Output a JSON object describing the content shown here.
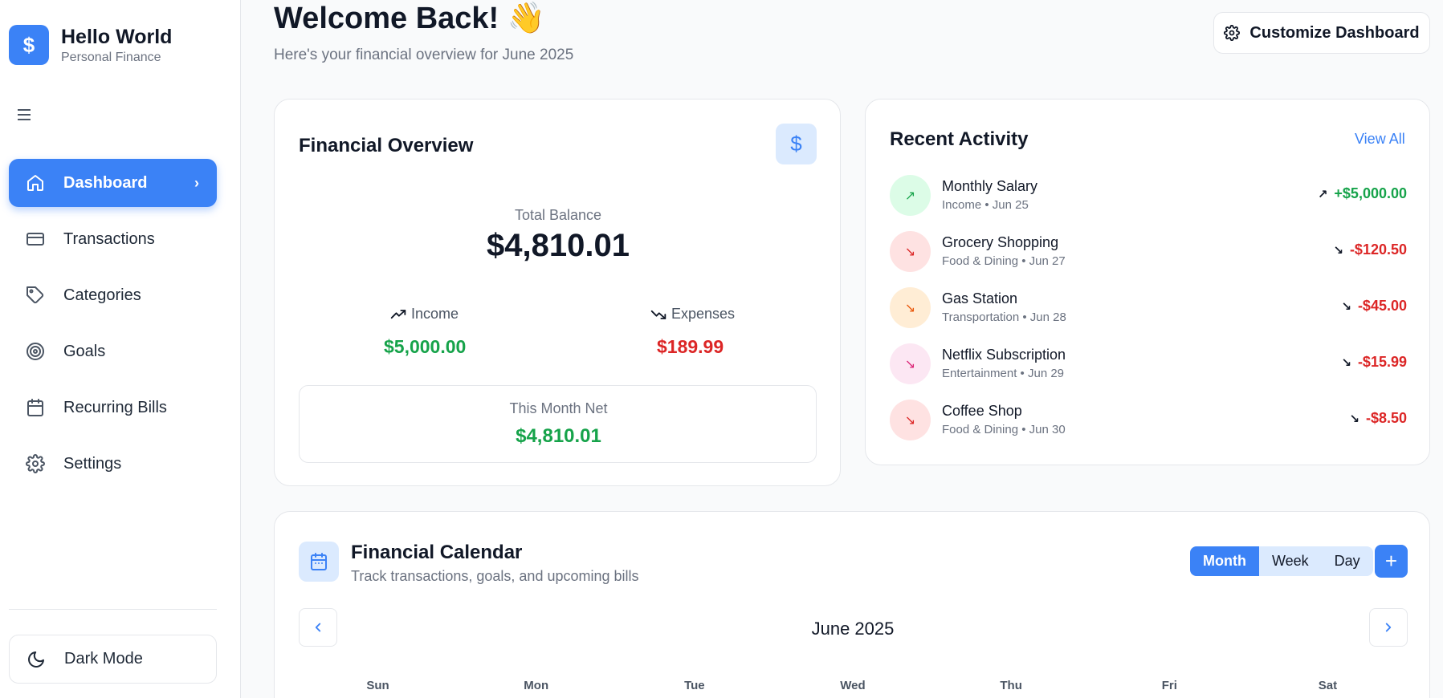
{
  "brand": {
    "name": "Hello World",
    "subtitle": "Personal Finance",
    "logo_symbol": "$"
  },
  "sidebar": {
    "items": [
      {
        "label": "Dashboard",
        "icon": "home-icon",
        "active": true
      },
      {
        "label": "Transactions",
        "icon": "credit-card-icon"
      },
      {
        "label": "Categories",
        "icon": "tag-icon"
      },
      {
        "label": "Goals",
        "icon": "target-icon"
      },
      {
        "label": "Recurring Bills",
        "icon": "calendar-icon"
      },
      {
        "label": "Settings",
        "icon": "gear-icon"
      }
    ],
    "dark_mode_label": "Dark Mode"
  },
  "header": {
    "title": "Welcome Back! 👋",
    "subtitle": "Here's your financial overview for June 2025",
    "customize_label": "Customize Dashboard"
  },
  "overview": {
    "title": "Financial Overview",
    "balance_label": "Total Balance",
    "balance_value": "$4,810.01",
    "income_label": "Income",
    "income_value": "$5,000.00",
    "expenses_label": "Expenses",
    "expenses_value": "$189.99",
    "net_label": "This Month Net",
    "net_value": "$4,810.01"
  },
  "activity": {
    "title": "Recent Activity",
    "view_all": "View All",
    "items": [
      {
        "name": "Monthly Salary",
        "meta": "Income • Jun 25",
        "amount": "+$5,000.00",
        "type": "income",
        "bg": "#dcfce7",
        "color": "#16a34a"
      },
      {
        "name": "Grocery Shopping",
        "meta": "Food & Dining • Jun 27",
        "amount": "-$120.50",
        "type": "expense",
        "bg": "#fee2e2",
        "color": "#dc2626"
      },
      {
        "name": "Gas Station",
        "meta": "Transportation • Jun 28",
        "amount": "-$45.00",
        "type": "expense",
        "bg": "#ffedd5",
        "color": "#ea580c"
      },
      {
        "name": "Netflix Subscription",
        "meta": "Entertainment • Jun 29",
        "amount": "-$15.99",
        "type": "expense",
        "bg": "#fce7f3",
        "color": "#db2777"
      },
      {
        "name": "Coffee Shop",
        "meta": "Food & Dining • Jun 30",
        "amount": "-$8.50",
        "type": "expense",
        "bg": "#fee2e2",
        "color": "#dc2626"
      }
    ]
  },
  "calendar": {
    "title": "Financial Calendar",
    "subtitle": "Track transactions, goals, and upcoming bills",
    "views": [
      "Month",
      "Week",
      "Day"
    ],
    "active_view": "Month",
    "month_label": "June 2025",
    "weekdays": [
      "Sun",
      "Mon",
      "Tue",
      "Wed",
      "Thu",
      "Fri",
      "Sat"
    ]
  },
  "colors": {
    "accent": "#3b82f6",
    "positive": "#16a34a",
    "negative": "#dc2626"
  }
}
